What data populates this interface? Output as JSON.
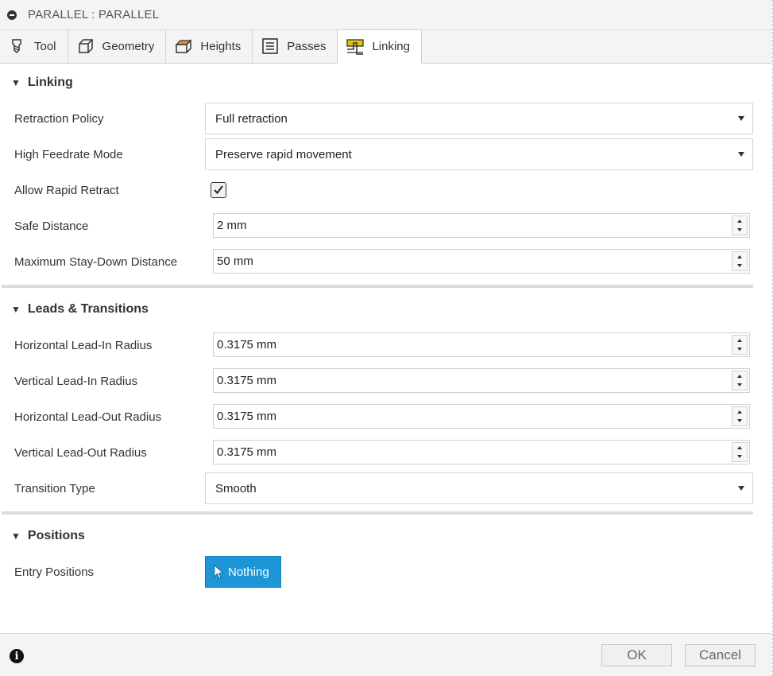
{
  "window": {
    "title": "PARALLEL : PARALLEL"
  },
  "tabs": [
    {
      "label": "Tool",
      "icon": "tool-icon",
      "active": false
    },
    {
      "label": "Geometry",
      "icon": "geometry-icon",
      "active": false
    },
    {
      "label": "Heights",
      "icon": "heights-icon",
      "active": false
    },
    {
      "label": "Passes",
      "icon": "passes-icon",
      "active": false
    },
    {
      "label": "Linking",
      "icon": "linking-icon",
      "active": true
    }
  ],
  "linking": {
    "header": "Linking",
    "retraction_policy": {
      "label": "Retraction Policy",
      "value": "Full retraction"
    },
    "high_feedrate_mode": {
      "label": "High Feedrate Mode",
      "value": "Preserve rapid movement"
    },
    "allow_rapid_retract": {
      "label": "Allow Rapid Retract",
      "checked": true
    },
    "safe_distance": {
      "label": "Safe Distance",
      "value": "2 mm"
    },
    "max_stay_down": {
      "label": "Maximum Stay-Down Distance",
      "value": "50 mm"
    }
  },
  "leads": {
    "header": "Leads & Transitions",
    "h_lead_in": {
      "label": "Horizontal Lead-In Radius",
      "value": "0.3175 mm"
    },
    "v_lead_in": {
      "label": "Vertical Lead-In Radius",
      "value": "0.3175 mm"
    },
    "h_lead_out": {
      "label": "Horizontal Lead-Out Radius",
      "value": "0.3175 mm"
    },
    "v_lead_out": {
      "label": "Vertical Lead-Out Radius",
      "value": "0.3175 mm"
    },
    "transition_type": {
      "label": "Transition Type",
      "value": "Smooth"
    }
  },
  "positions": {
    "header": "Positions",
    "entry_positions": {
      "label": "Entry Positions",
      "button": "Nothing"
    }
  },
  "footer": {
    "ok": "OK",
    "cancel": "Cancel"
  },
  "colors": {
    "accent": "#1e95d6",
    "tab_icon_orange": "#e8912b",
    "linking_icon_yellow": "#e2c400"
  }
}
